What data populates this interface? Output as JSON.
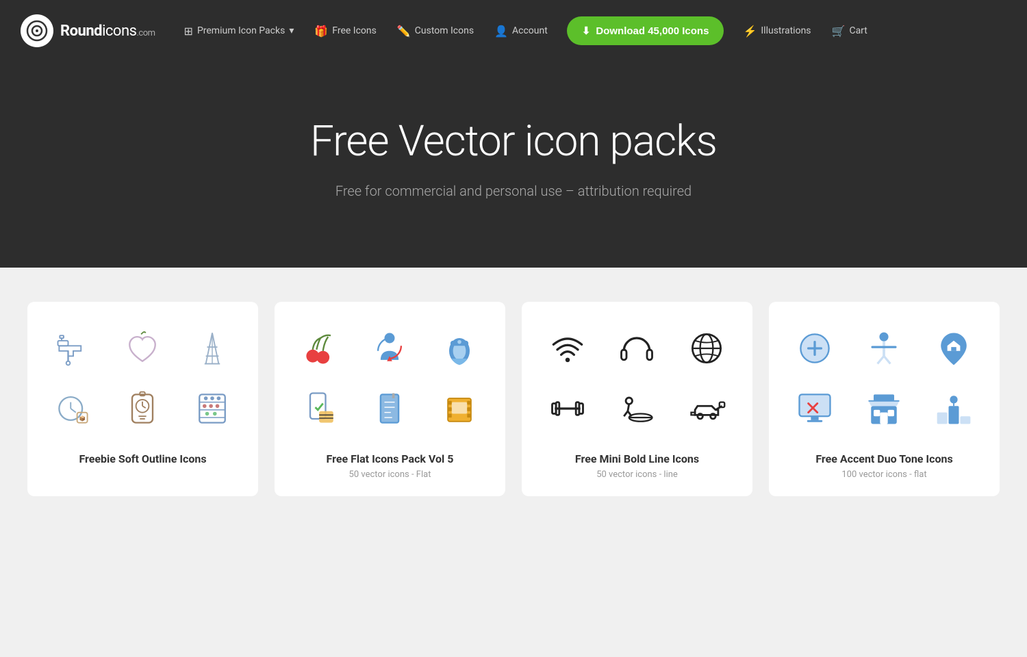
{
  "navbar": {
    "logo": {
      "brand": "Round",
      "brand2": "icons",
      "tld": ".com"
    },
    "nav_items": [
      {
        "id": "premium-icon-packs",
        "label": "Premium Icon Packs",
        "icon": "⊞",
        "has_dropdown": true
      },
      {
        "id": "free-icons",
        "label": "Free Icons",
        "icon": "🎁"
      },
      {
        "id": "custom-icons",
        "label": "Custom Icons",
        "icon": "✏️"
      },
      {
        "id": "account",
        "label": "Account",
        "icon": "👤"
      }
    ],
    "cta_button": {
      "label": "Download 45,000 Icons",
      "icon": "⬇"
    },
    "right_items": [
      {
        "id": "illustrations",
        "label": "Illustrations",
        "icon": "⚡"
      },
      {
        "id": "cart",
        "label": "Cart",
        "icon": "🛒"
      }
    ]
  },
  "hero": {
    "title": "Free Vector icon packs",
    "subtitle": "Free for commercial and personal use – attribution required"
  },
  "cards": [
    {
      "id": "freebie-soft-outline",
      "title": "Freebie Soft Outline Icons",
      "subtitle": "",
      "icons": [
        "faucet",
        "apple-heart",
        "eiffel",
        "compass",
        "clock",
        "abacus"
      ]
    },
    {
      "id": "free-flat-vol5",
      "title": "Free Flat Icons Pack Vol 5",
      "subtitle": "50 vector icons - Flat",
      "icons": [
        "cherry",
        "person-rotate",
        "phone",
        "mobile-check",
        "blueprint",
        "film"
      ]
    },
    {
      "id": "free-mini-bold-line",
      "title": "Free Mini Bold Line Icons",
      "subtitle": "50 vector icons - line",
      "icons": [
        "wifi",
        "headphones",
        "globe",
        "barbell",
        "treadmill",
        "car-plug"
      ]
    },
    {
      "id": "free-accent-duo-tone",
      "title": "Free Accent Duo Tone Icons",
      "subtitle": "100 vector icons - flat",
      "icons": [
        "add-circle",
        "person-spread",
        "location-home",
        "monitor-cancel",
        "store-blue",
        "podium"
      ]
    }
  ]
}
